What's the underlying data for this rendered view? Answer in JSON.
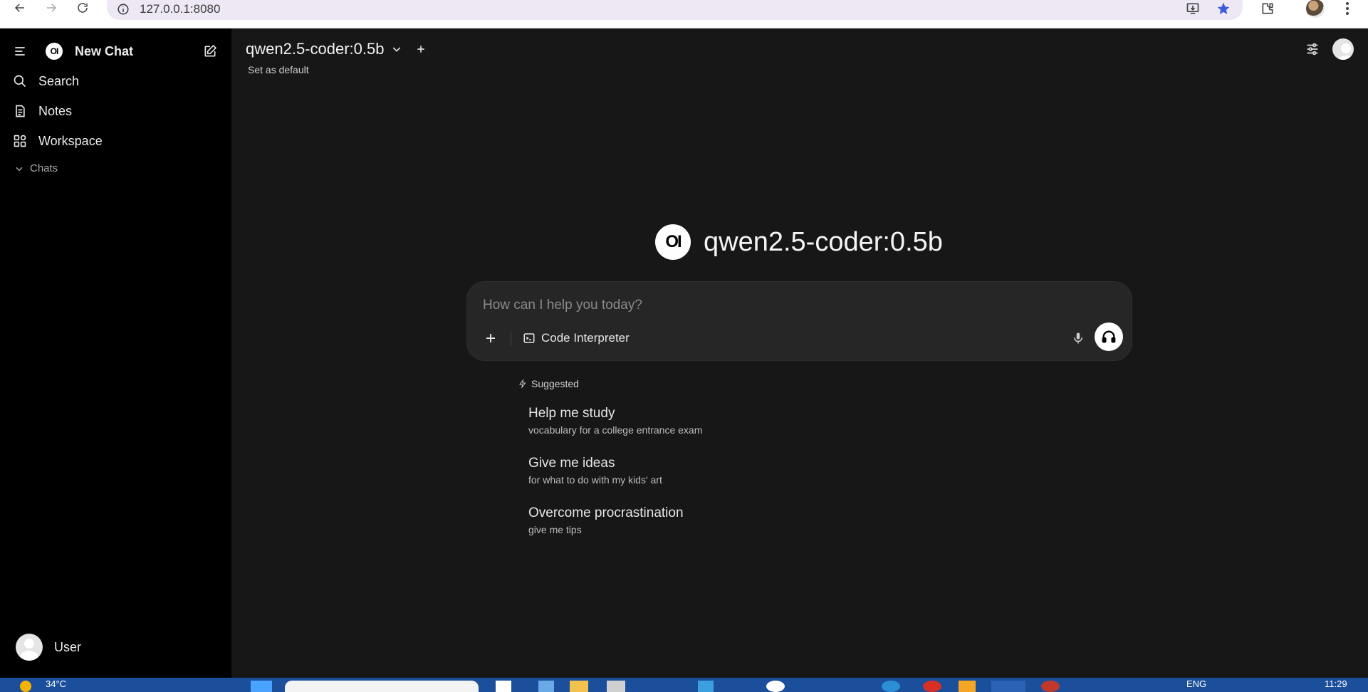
{
  "browser": {
    "url": "127.0.0.1:8080"
  },
  "sidebar": {
    "new_chat": "New Chat",
    "items": [
      {
        "label": "Search",
        "icon": "search-icon"
      },
      {
        "label": "Notes",
        "icon": "notes-icon"
      },
      {
        "label": "Workspace",
        "icon": "workspace-icon"
      }
    ],
    "chats_section": "Chats",
    "user_name": "User"
  },
  "header": {
    "model_name": "qwen2.5-coder:0.5b",
    "set_default": "Set as default"
  },
  "main": {
    "hero_title": "qwen2.5-coder:0.5b",
    "logo_text": "OI",
    "prompt_placeholder": "How can I help you today?",
    "code_interpreter": "Code Interpreter",
    "suggested_label": "Suggested",
    "suggestions": [
      {
        "title": "Help me study",
        "subtitle": "vocabulary for a college entrance exam"
      },
      {
        "title": "Give me ideas",
        "subtitle": "for what to do with my kids' art"
      },
      {
        "title": "Overcome procrastination",
        "subtitle": "give me tips"
      }
    ]
  },
  "taskbar": {
    "weather": "34°C",
    "lang": "ENG",
    "time": "11:29"
  },
  "colors": {
    "sidebar_bg": "#000000",
    "main_bg": "#171717",
    "prompt_bg": "#262626",
    "taskbar_bg": "#1b4f9c"
  }
}
